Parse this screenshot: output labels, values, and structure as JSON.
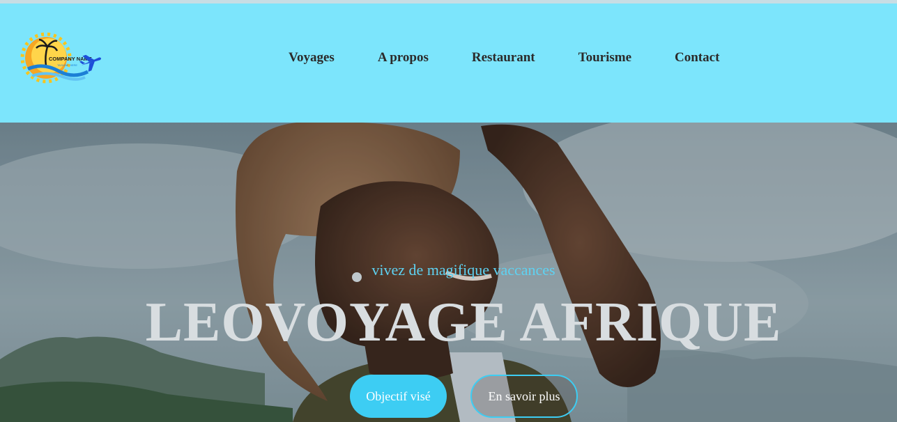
{
  "logo": {
    "company_name": "COMPANY NAME",
    "tagline": "TAGLINE HERE"
  },
  "nav": {
    "items": [
      {
        "label": "Voyages"
      },
      {
        "label": "A propos"
      },
      {
        "label": "Restaurant"
      },
      {
        "label": "Tourisme"
      },
      {
        "label": "Contact"
      }
    ]
  },
  "hero": {
    "subtitle": "vivez de magifique vaccances",
    "title": "LEOVOYAGE AFRIQUE",
    "primary_button": "Objectif visé",
    "secondary_button": "En savoir plus"
  },
  "colors": {
    "header_bg": "#7ce5fc",
    "accent": "#3dcdf3",
    "nav_text": "#2b2b2b",
    "title_text": "#d8dde0"
  }
}
